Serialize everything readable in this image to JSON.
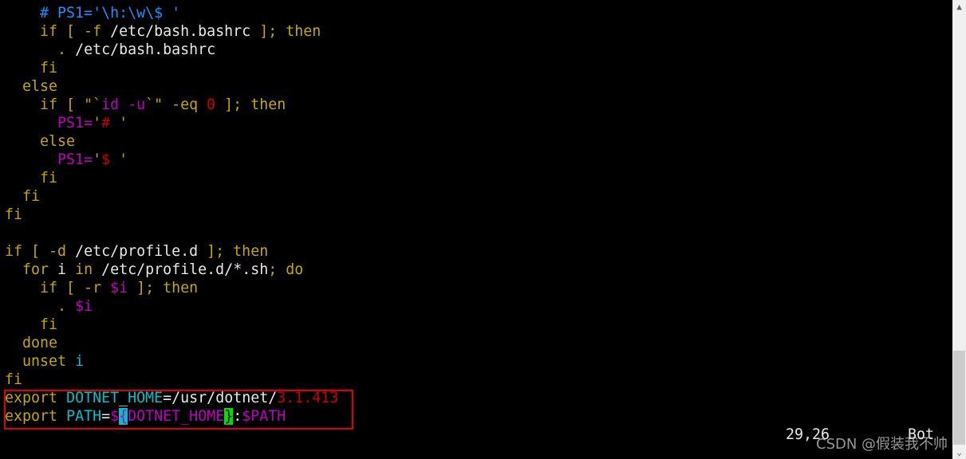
{
  "colors": {
    "white": "#e8e8e8",
    "yellow": "#c4a800",
    "blue": "#1f8fff",
    "magenta": "#c000c0",
    "red": "#c80000",
    "cyan": "#00c0c8",
    "highlight_box": "#e00000"
  },
  "lines": [
    [
      [
        "    ",
        "white"
      ],
      [
        "# PS1='\\h:\\w\\$ '",
        "blue"
      ]
    ],
    [
      [
        "    ",
        "white"
      ],
      [
        "if [ -f ",
        "yellow"
      ],
      [
        "/etc/bash.bashrc",
        "white"
      ],
      [
        " ]; then",
        "yellow"
      ]
    ],
    [
      [
        "      ",
        "white"
      ],
      [
        ".",
        "yellow"
      ],
      [
        " /etc/bash.bashrc",
        "white"
      ]
    ],
    [
      [
        "    ",
        "white"
      ],
      [
        "fi",
        "yellow"
      ]
    ],
    [
      [
        "  ",
        "white"
      ],
      [
        "else",
        "yellow"
      ]
    ],
    [
      [
        "    ",
        "white"
      ],
      [
        "if [ ",
        "yellow"
      ],
      [
        "\"`",
        "yellow"
      ],
      [
        "id -u",
        "magenta"
      ],
      [
        "`\" -eq ",
        "yellow"
      ],
      [
        "0",
        "red"
      ],
      [
        " ]; then",
        "yellow"
      ]
    ],
    [
      [
        "      ",
        "white"
      ],
      [
        "PS1=",
        "magenta"
      ],
      [
        "'",
        "yellow"
      ],
      [
        "# ",
        "red"
      ],
      [
        "'",
        "yellow"
      ]
    ],
    [
      [
        "    ",
        "white"
      ],
      [
        "else",
        "yellow"
      ]
    ],
    [
      [
        "      ",
        "white"
      ],
      [
        "PS1=",
        "magenta"
      ],
      [
        "'",
        "yellow"
      ],
      [
        "$ ",
        "red"
      ],
      [
        "'",
        "yellow"
      ]
    ],
    [
      [
        "    ",
        "white"
      ],
      [
        "fi",
        "yellow"
      ]
    ],
    [
      [
        "  ",
        "white"
      ],
      [
        "fi",
        "yellow"
      ]
    ],
    [
      [
        "fi",
        "yellow"
      ]
    ],
    [],
    [
      [
        "if [ -d ",
        "yellow"
      ],
      [
        "/etc/profile.d",
        "white"
      ],
      [
        " ]; then",
        "yellow"
      ]
    ],
    [
      [
        "  ",
        "white"
      ],
      [
        "for",
        "yellow"
      ],
      [
        " i ",
        "white"
      ],
      [
        "in",
        "yellow"
      ],
      [
        " /etc/profile.d/*.sh",
        "white"
      ],
      [
        "; do",
        "yellow"
      ]
    ],
    [
      [
        "    ",
        "white"
      ],
      [
        "if [ -r ",
        "yellow"
      ],
      [
        "$i",
        "magenta"
      ],
      [
        " ]; then",
        "yellow"
      ]
    ],
    [
      [
        "      ",
        "white"
      ],
      [
        ".",
        "yellow"
      ],
      [
        " ",
        "white"
      ],
      [
        "$i",
        "magenta"
      ]
    ],
    [
      [
        "    ",
        "white"
      ],
      [
        "fi",
        "yellow"
      ]
    ],
    [
      [
        "  ",
        "white"
      ],
      [
        "done",
        "yellow"
      ]
    ],
    [
      [
        "  ",
        "white"
      ],
      [
        "unset",
        "yellow"
      ],
      [
        " ",
        "white"
      ],
      [
        "i",
        "cyan"
      ]
    ],
    [
      [
        "fi",
        "yellow"
      ]
    ],
    [
      [
        "export",
        "yellow"
      ],
      [
        " ",
        "white"
      ],
      [
        "DOTNET",
        "cyan"
      ],
      [
        "_",
        "white"
      ],
      [
        "HOME",
        "cyan"
      ],
      [
        "=/usr/dotnet/",
        "white"
      ],
      [
        "3.1.413",
        "red"
      ]
    ],
    [
      [
        "export",
        "yellow"
      ],
      [
        " ",
        "white"
      ],
      [
        "PATH",
        "cyan"
      ],
      [
        "=",
        "white"
      ],
      [
        "$",
        "magenta"
      ],
      [
        "{",
        "hl-cyan"
      ],
      [
        "DOTNET_HOME",
        "magenta"
      ],
      [
        "}",
        "hl-green"
      ],
      [
        ":",
        "white"
      ],
      [
        "$PATH",
        "magenta"
      ]
    ]
  ],
  "status": {
    "position": "29,26",
    "scroll": "Bot"
  },
  "watermark": "CSDN @假装我不帅",
  "scrollbar": {
    "up_icon": "chevron-up-icon",
    "down_icon": "chevron-down-icon",
    "position": "bottom"
  }
}
